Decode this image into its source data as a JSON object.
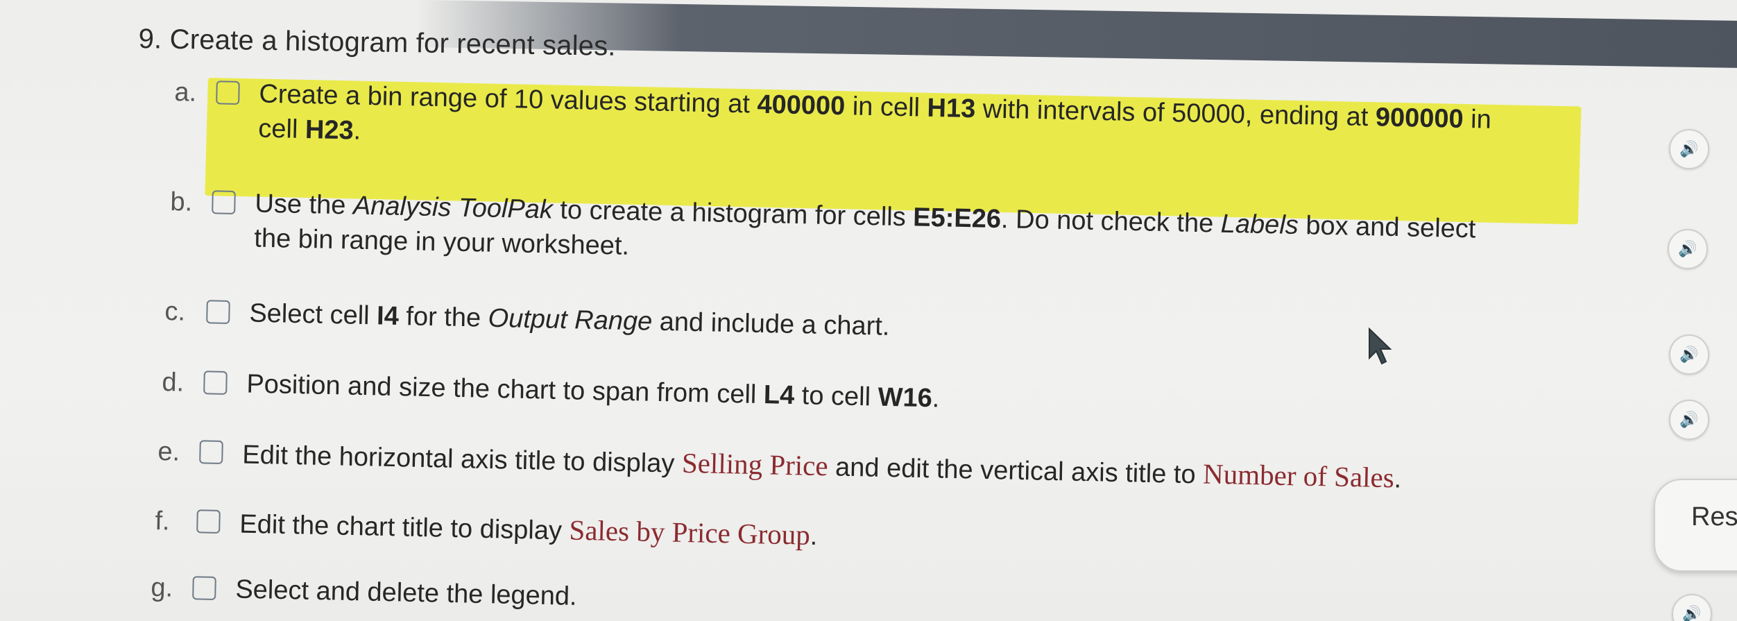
{
  "question": {
    "number": "9.",
    "title": "Create a histogram for recent sales."
  },
  "steps": [
    {
      "letter": "a.",
      "highlighted": true,
      "segments": [
        {
          "text": "Create a bin range of 10 values starting at ",
          "style": "normal"
        },
        {
          "text": "400000",
          "style": "bold"
        },
        {
          "text": " in cell ",
          "style": "normal"
        },
        {
          "text": "H13",
          "style": "bold"
        },
        {
          "text": " with intervals of 50000, ending at ",
          "style": "normal"
        },
        {
          "text": "900000",
          "style": "bold"
        },
        {
          "text": " in",
          "style": "normal"
        },
        {
          "text": "\n",
          "style": "break"
        },
        {
          "text": "cell ",
          "style": "normal"
        },
        {
          "text": "H23",
          "style": "bold"
        },
        {
          "text": ".",
          "style": "normal"
        }
      ]
    },
    {
      "letter": "b.",
      "highlighted": false,
      "segments": [
        {
          "text": "Use the ",
          "style": "normal"
        },
        {
          "text": "Analysis ToolPak",
          "style": "italic"
        },
        {
          "text": " to create a histogram for cells ",
          "style": "normal"
        },
        {
          "text": "E5:E26",
          "style": "bold"
        },
        {
          "text": ". Do not check the ",
          "style": "normal"
        },
        {
          "text": "Labels",
          "style": "italic"
        },
        {
          "text": " box and select",
          "style": "normal"
        },
        {
          "text": "\n",
          "style": "break"
        },
        {
          "text": "the bin range in your worksheet.",
          "style": "normal"
        }
      ]
    },
    {
      "letter": "c.",
      "highlighted": false,
      "segments": [
        {
          "text": "Select cell ",
          "style": "normal"
        },
        {
          "text": "I4",
          "style": "bold"
        },
        {
          "text": " for the ",
          "style": "normal"
        },
        {
          "text": "Output Range",
          "style": "italic"
        },
        {
          "text": " and include a chart.",
          "style": "normal"
        }
      ]
    },
    {
      "letter": "d.",
      "highlighted": false,
      "segments": [
        {
          "text": "Position and size the chart to span from cell ",
          "style": "normal"
        },
        {
          "text": "L4",
          "style": "bold"
        },
        {
          "text": " to cell ",
          "style": "normal"
        },
        {
          "text": "W16",
          "style": "bold"
        },
        {
          "text": ".",
          "style": "normal"
        }
      ]
    },
    {
      "letter": "e.",
      "highlighted": false,
      "segments": [
        {
          "text": "Edit the horizontal axis title to display ",
          "style": "normal"
        },
        {
          "text": "Selling Price",
          "style": "serif-red"
        },
        {
          "text": " and edit the vertical axis title to ",
          "style": "normal"
        },
        {
          "text": "Number of Sales",
          "style": "serif-red"
        },
        {
          "text": ".",
          "style": "normal"
        }
      ]
    },
    {
      "letter": "f.",
      "highlighted": false,
      "segments": [
        {
          "text": "Edit the chart title to display ",
          "style": "normal"
        },
        {
          "text": "Sales by Price Group",
          "style": "serif-red"
        },
        {
          "text": ".",
          "style": "normal"
        }
      ]
    },
    {
      "letter": "g.",
      "highlighted": false,
      "segments": [
        {
          "text": "Select and delete the legend.",
          "style": "normal"
        }
      ]
    }
  ],
  "audio_icon": "speaker-icon",
  "audio_glyph": "🔊",
  "res_button_label": "Res",
  "colors": {
    "highlight": "#e9ea4a",
    "accent_text": "#8a2b30"
  }
}
